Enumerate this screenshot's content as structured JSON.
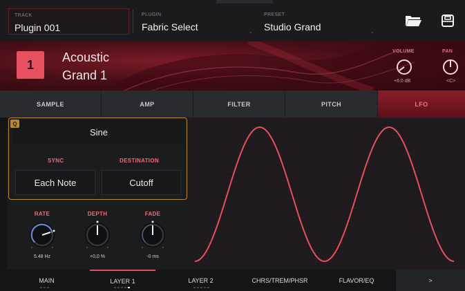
{
  "header": {
    "track": {
      "label": "TRACK",
      "value": "Plugin 001"
    },
    "plugin": {
      "label": "PLUGIN",
      "value": "Fabric Select"
    },
    "preset": {
      "label": "PRESET",
      "value": "Studio Grand"
    },
    "icons": [
      "folder-icon",
      "save-icon"
    ]
  },
  "instrument": {
    "number": "1",
    "name_line1": "Acoustic",
    "name_line2": "Grand 1",
    "volume": {
      "label": "VOLUME",
      "value": "+6.0 dB"
    },
    "pan": {
      "label": "PAN",
      "value": "<C>"
    }
  },
  "tabs": [
    {
      "label": "SAMPLE",
      "active": false
    },
    {
      "label": "AMP",
      "active": false
    },
    {
      "label": "FILTER",
      "active": false
    },
    {
      "label": "PITCH",
      "active": false
    },
    {
      "label": "LFO",
      "active": true
    }
  ],
  "lfo": {
    "q_badge": "Q",
    "waveform": "Sine",
    "sync": {
      "label": "SYNC",
      "value": "Each Note"
    },
    "destination": {
      "label": "DESTINATION",
      "value": "Cutoff"
    },
    "rate": {
      "label": "RATE",
      "value": "5.48 Hz"
    },
    "depth": {
      "label": "DEPTH",
      "value": "+0.0 %"
    },
    "fade": {
      "label": "FADE",
      "value": "-0 ms"
    },
    "wave_color": "#e8505f"
  },
  "bottom_nav": [
    {
      "label": "MAIN",
      "active": false
    },
    {
      "label": "LAYER 1",
      "active": true
    },
    {
      "label": "LAYER 2",
      "active": false
    },
    {
      "label": "CHRS/TREM/PHSR",
      "active": false
    },
    {
      "label": "FLAVOR/EQ",
      "active": false
    },
    {
      "label": ">",
      "active": false
    }
  ],
  "colors": {
    "accent": "#e8505f",
    "q_gold": "#b8892f"
  }
}
